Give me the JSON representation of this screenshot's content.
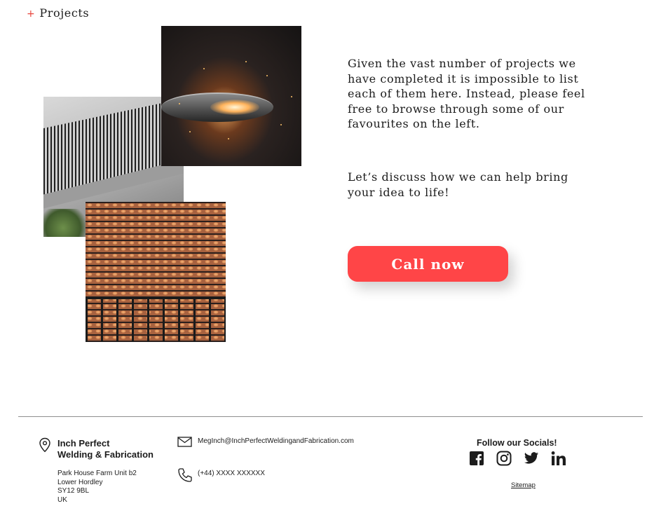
{
  "section": {
    "title": "Projects",
    "marker": "+"
  },
  "gallery": {
    "images": [
      {
        "name": "stair-railing-photo"
      },
      {
        "name": "welding-sparks-photo"
      },
      {
        "name": "metal-mesh-panel-photo"
      }
    ]
  },
  "intro": {
    "paragraph1": "Given the vast number of projects we have completed  it is impossible to list each of them here. Instead, please feel free to browse through some of our favourites on the left.",
    "paragraph2": "Let’s discuss how we can help bring your idea to life!"
  },
  "cta": {
    "label": "Call now",
    "color": "#ff4547"
  },
  "footer": {
    "company_line1": "Inch Perfect",
    "company_line2": "Welding & Fabrication",
    "address": [
      "Park House Farm Unit b2",
      "Lower Hordley",
      "SY12 9BL",
      "UK"
    ],
    "email": "MegInch@InchPerfectWeldingandFabrication.com",
    "phone": "(+44) XXXX XXXXXX",
    "social_heading": "Follow our Socials!",
    "socials": [
      "facebook-icon",
      "instagram-icon",
      "twitter-icon",
      "linkedin-icon"
    ],
    "sitemap_label": "Sitemap"
  }
}
